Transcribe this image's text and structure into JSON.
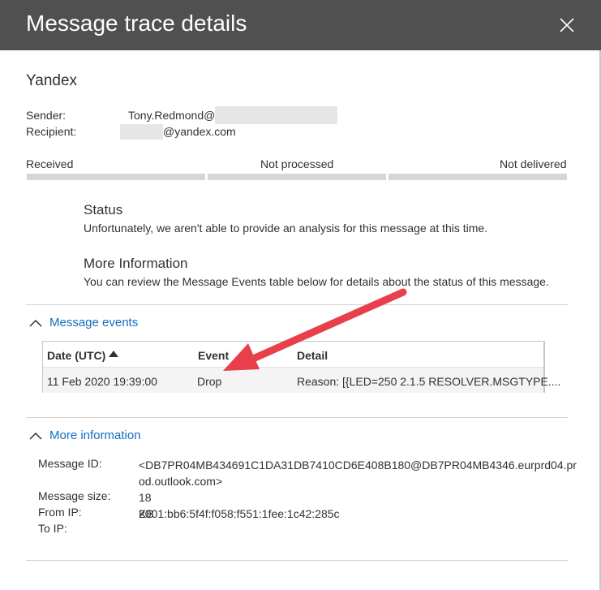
{
  "panel": {
    "title": "Message trace details",
    "close_icon": "close-icon"
  },
  "message": {
    "subject": "Yandex",
    "sender_label": "Sender:",
    "sender_value": "Tony.Redmond@",
    "recipient_label": "Recipient:",
    "recipient_value": "@yandex.com"
  },
  "stages": {
    "received": "Received",
    "processed": "Not processed",
    "delivered": "Not delivered"
  },
  "status": {
    "title": "Status",
    "text": "Unfortunately, we aren't able to provide an analysis for this message at this time."
  },
  "more_info_block": {
    "title": "More Information",
    "text": "You can review the Message Events table below for details about the status of this message."
  },
  "events_section": {
    "toggle_label": "Message events",
    "columns": [
      "Date (UTC)",
      "Event",
      "Detail"
    ],
    "rows": [
      {
        "date": "11 Feb 2020 19:39:00",
        "event": "Drop",
        "detail": "Reason: [{LED=250 2.1.5 RESOLVER.MSGTYPE...."
      }
    ]
  },
  "info_section": {
    "toggle_label": "More information",
    "message_id_label": "Message ID:",
    "message_id_line1": "<DB7PR04MB434691C1DA31DB7410CD6E408B180@DB7PR04MB4346.eurprd04.pr",
    "message_id_line2": "od.outlook.com>",
    "size_label": "Message size:",
    "size_value": "18 KB",
    "from_ip_label": "From IP:",
    "from_ip_value": "2001:bb6:5f4f:f058:f551:1fee:1c42:285c",
    "to_ip_label": "To IP:",
    "to_ip_value": ""
  },
  "colors": {
    "header_bg": "#505050",
    "link": "#106ebe",
    "arrow": "#e8404a"
  }
}
